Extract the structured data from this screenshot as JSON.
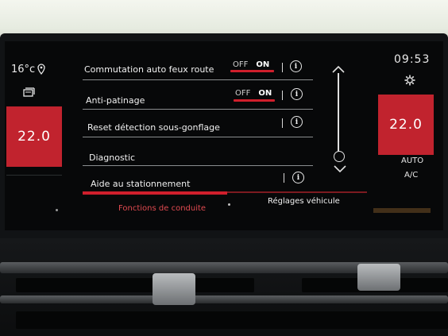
{
  "climate": {
    "outside_temp": "16°c",
    "left_temp": "22.0",
    "right_temp": "22.0",
    "auto_label": "AUTO",
    "ac_label": "A/C"
  },
  "status": {
    "clock": "09:53"
  },
  "menu": {
    "rows": [
      {
        "label": "Commutation auto feux route",
        "toggle": {
          "off": "OFF",
          "on": "ON"
        },
        "info": "i"
      },
      {
        "label": "Anti-patinage",
        "toggle": {
          "off": "OFF",
          "on": "ON"
        },
        "info": "i"
      },
      {
        "label": "Reset détection sous-gonflage",
        "info": "i"
      },
      {
        "label": "Diagnostic"
      },
      {
        "label": "Aide au stationnement",
        "info": "i"
      }
    ]
  },
  "tabs": [
    {
      "label": "Fonctions de conduite",
      "active": true
    },
    {
      "label": "Réglages véhicule",
      "active": false
    }
  ],
  "icons": {
    "location": "location-pin-icon",
    "seat": "seat-icon",
    "settings": "gear-icon",
    "info": "info-icon",
    "scroll_up": "chevron-up-icon",
    "scroll_down": "chevron-down-icon"
  },
  "colors": {
    "accent_red": "#d01f2c",
    "temp_box": "#c1232e",
    "screen_bg": "#070809"
  }
}
